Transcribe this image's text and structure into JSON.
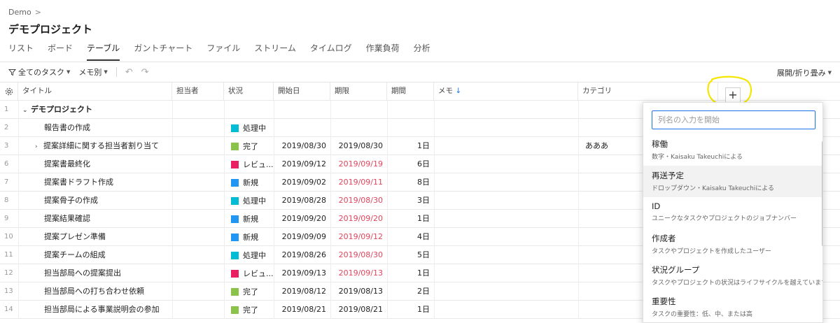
{
  "breadcrumb": {
    "label": "Demo",
    "separator": ">"
  },
  "page": {
    "title": "デモプロジェクト"
  },
  "tabs": [
    {
      "label": "リスト",
      "active": false
    },
    {
      "label": "ボード",
      "active": false
    },
    {
      "label": "テーブル",
      "active": true
    },
    {
      "label": "ガントチャート",
      "active": false
    },
    {
      "label": "ファイル",
      "active": false
    },
    {
      "label": "ストリーム",
      "active": false
    },
    {
      "label": "タイムログ",
      "active": false
    },
    {
      "label": "作業負荷",
      "active": false
    },
    {
      "label": "分析",
      "active": false
    }
  ],
  "toolbar": {
    "filter_label": "全てのタスク",
    "group_label": "メモ別",
    "undo_icon": "undo-icon",
    "redo_icon": "redo-icon",
    "expand_collapse_label": "展開/折り畳み"
  },
  "table": {
    "columns": {
      "title": "タイトル",
      "assignee": "担当者",
      "status": "状況",
      "start": "開始日",
      "due": "期限",
      "duration": "期間",
      "memo": "メモ",
      "memo_sort_icon": "↓",
      "category": "カテゴリ"
    },
    "rows": [
      {
        "num": "1",
        "title": "デモプロジェクト",
        "group": true,
        "expander": "⌄"
      },
      {
        "num": "2",
        "title": "報告書の作成",
        "status": "処理中",
        "status_color": "#00bcd4",
        "start": "",
        "due": "",
        "duration": "",
        "category": ""
      },
      {
        "num": "3",
        "title": "提案詳細に関する担当者割り当て",
        "expander": "›",
        "status": "完了",
        "status_color": "#8bc34a",
        "start": "2019/08/30",
        "due": "2019/08/30",
        "overdue": false,
        "duration": "1日",
        "category": "あああ"
      },
      {
        "num": "6",
        "title": "提案書最終化",
        "status": "レビュ...",
        "status_color": "#e91e63",
        "start": "2019/09/12",
        "due": "2019/09/19",
        "overdue": true,
        "duration": "6日",
        "category": ""
      },
      {
        "num": "7",
        "title": "提案書ドラフト作成",
        "status": "新規",
        "status_color": "#2196f3",
        "start": "2019/09/02",
        "due": "2019/09/11",
        "overdue": true,
        "duration": "8日",
        "category": ""
      },
      {
        "num": "8",
        "title": "提案骨子の作成",
        "status": "処理中",
        "status_color": "#00bcd4",
        "start": "2019/08/28",
        "due": "2019/08/30",
        "overdue": true,
        "duration": "3日",
        "category": ""
      },
      {
        "num": "9",
        "title": "提案結果確認",
        "status": "新規",
        "status_color": "#2196f3",
        "start": "2019/09/20",
        "due": "2019/09/20",
        "overdue": true,
        "duration": "1日",
        "category": ""
      },
      {
        "num": "10",
        "title": "提案プレゼン準備",
        "status": "新規",
        "status_color": "#2196f3",
        "start": "2019/09/09",
        "due": "2019/09/12",
        "overdue": true,
        "duration": "4日",
        "category": ""
      },
      {
        "num": "11",
        "title": "提案チームの組成",
        "status": "処理中",
        "status_color": "#00bcd4",
        "start": "2019/08/26",
        "due": "2019/08/30",
        "overdue": true,
        "duration": "5日",
        "category": ""
      },
      {
        "num": "12",
        "title": "担当部局への提案提出",
        "status": "レビュ...",
        "status_color": "#e91e63",
        "start": "2019/09/13",
        "due": "2019/09/13",
        "overdue": true,
        "duration": "1日",
        "category": ""
      },
      {
        "num": "13",
        "title": "担当部局への打ち合わせ依頼",
        "status": "完了",
        "status_color": "#8bc34a",
        "start": "2019/08/12",
        "due": "2019/08/13",
        "overdue": false,
        "duration": "2日",
        "category": ""
      },
      {
        "num": "14",
        "title": "担当部局による事業説明会の参加",
        "status": "完了",
        "status_color": "#8bc34a",
        "start": "2019/08/21",
        "due": "2019/08/21",
        "overdue": false,
        "duration": "1日",
        "category": ""
      }
    ]
  },
  "add_column": {
    "label": "+"
  },
  "column_picker": {
    "search_placeholder": "列名の入力を開始",
    "items": [
      {
        "name": "稼働",
        "desc": "数字・Kaisaku Takeuchiによる",
        "hover": false
      },
      {
        "name": "再送予定",
        "desc": "ドロップダウン・Kaisaku Takeuchiによる",
        "hover": true
      },
      {
        "name": "ID",
        "desc": "ユニークなタスクやプロジェクトのジョブナンバー",
        "hover": false
      },
      {
        "name": "作成者",
        "desc": "タスクやプロジェクトを作成したユーザー",
        "hover": false
      },
      {
        "name": "状況グループ",
        "desc": "タスクやプロジェクトの状況はライフサイクルを越えています",
        "hover": false
      },
      {
        "name": "重要性",
        "desc": "タスクの重要性：低、中、または高",
        "hover": false
      }
    ]
  },
  "colors": {
    "overdue": "#e2445c",
    "annotation_highlight": "#f5e600",
    "input_focus": "#1a73e8"
  }
}
